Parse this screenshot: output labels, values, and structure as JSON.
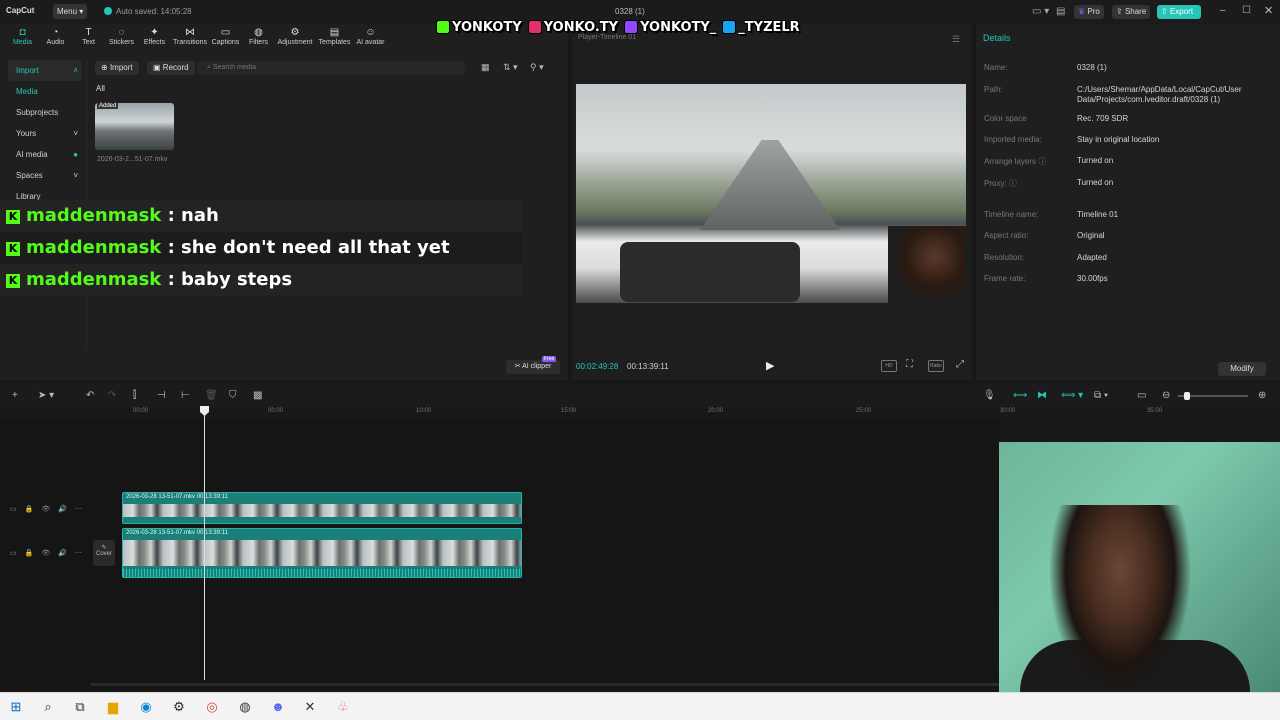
{
  "app": {
    "logo": "CapCut",
    "menu": "Menu",
    "autosave": "Auto saved: 14:05:28",
    "doc_title": "0328 (1)"
  },
  "titlebar": {
    "pro": "Pro",
    "share": "Share",
    "export": "Export"
  },
  "overlay_socials": [
    {
      "handle": "YONKOTY",
      "color": "#53fc18"
    },
    {
      "handle": "YONKO.TY",
      "color": "#e1306c"
    },
    {
      "handle": "YONKOTY_",
      "color": "#9146ff"
    },
    {
      "handle": "_TYZELR",
      "color": "#1da1f2"
    }
  ],
  "tools": [
    {
      "label": "Media",
      "icon": "◘"
    },
    {
      "label": "Audio",
      "icon": "◔"
    },
    {
      "label": "Text",
      "icon": "T"
    },
    {
      "label": "Stickers",
      "icon": "◌"
    },
    {
      "label": "Effects",
      "icon": "✦"
    },
    {
      "label": "Transitions",
      "icon": "⋈"
    },
    {
      "label": "Captions",
      "icon": "▭"
    },
    {
      "label": "Filters",
      "icon": "◍"
    },
    {
      "label": "Adjustment",
      "icon": "⚙"
    },
    {
      "label": "Templates",
      "icon": "▤"
    },
    {
      "label": "AI avatar",
      "icon": "☺"
    }
  ],
  "leftnav": {
    "import": "Import",
    "media": "Media",
    "subprojects": "Subprojects",
    "yours": "Yours",
    "ai_media": "AI media",
    "spaces": "Spaces",
    "library": "Library"
  },
  "media": {
    "import_btn": "Import",
    "record_btn": "Record",
    "search_placeholder": "Search media",
    "filter_all": "All",
    "thumb_badge": "Added",
    "thumb_name": "2026-03-2...51-07.mkv",
    "ai_clipper": "AI clipper",
    "free_badge": "Free"
  },
  "chat": [
    {
      "user": "maddenmask",
      "msg": ": nah"
    },
    {
      "user": "maddenmask",
      "msg": ": she don't need all that yet"
    },
    {
      "user": "maddenmask",
      "msg": ": baby steps"
    }
  ],
  "player": {
    "title": "Player-Timeline 01",
    "current": "00:02:49:28",
    "total": "00:13:39:11"
  },
  "details": {
    "title": "Details",
    "rows": [
      {
        "label": "Name:",
        "value": "0328 (1)"
      },
      {
        "label": "Path:",
        "value": "C:/Users/Shemar/AppData/Local/CapCut/User Data/Projects/com.lveditor.draft/0328 (1)"
      },
      {
        "label": "Color space",
        "value": "Rec. 709 SDR"
      },
      {
        "label": "Imported media:",
        "value": "Stay in original location"
      },
      {
        "label": "Arrange layers ⓘ",
        "value": "Turned on"
      },
      {
        "label": "Proxy: ⓘ",
        "value": "Turned on"
      },
      {
        "label": "Timeline name:",
        "value": "Timeline 01"
      },
      {
        "label": "Aspect ratio:",
        "value": "Original"
      },
      {
        "label": "Resolution:",
        "value": "Adapted"
      },
      {
        "label": "Frame rate:",
        "value": "30.00fps"
      }
    ],
    "modify": "Modify"
  },
  "ruler": [
    "00:00",
    "00:00",
    "10:00",
    "15:00",
    "20:00",
    "25:00",
    "30:00",
    "35:00"
  ],
  "clips": [
    {
      "name": "2026-03-28 13-51-07.mkv",
      "duration": "00:13:39:11"
    },
    {
      "name": "2026-03-28 13-51-07.mkv",
      "duration": "00:13:39:11"
    }
  ],
  "cover": "Cover",
  "colors": {
    "accent": "#25c6b8",
    "kick_green": "#53fc18",
    "pro": "#8a5cf6"
  }
}
